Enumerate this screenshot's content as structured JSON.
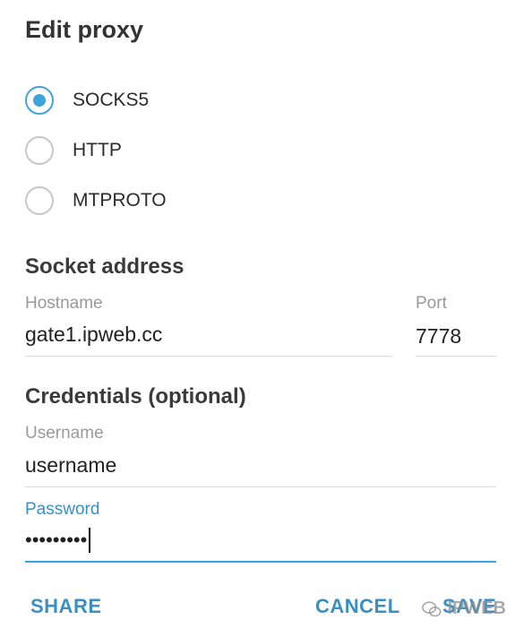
{
  "dialog": {
    "title": "Edit proxy"
  },
  "proxy_type": {
    "options": [
      {
        "label": "SOCKS5",
        "checked": true
      },
      {
        "label": "HTTP",
        "checked": false
      },
      {
        "label": "MTPROTO",
        "checked": false
      }
    ]
  },
  "socket_address": {
    "section_title": "Socket address",
    "hostname": {
      "label": "Hostname",
      "value": "gate1.ipweb.cc"
    },
    "port": {
      "label": "Port",
      "value": "7778"
    }
  },
  "credentials": {
    "section_title": "Credentials (optional)",
    "username": {
      "label": "Username",
      "value": "username"
    },
    "password": {
      "label": "Password",
      "value": "•••••••••"
    }
  },
  "actions": {
    "share_label": "SHARE",
    "cancel_label": "CANCEL",
    "save_label": "SAVE"
  },
  "watermark": {
    "text": "IPWEB"
  },
  "colors": {
    "accent": "#3fa3dc",
    "accent_text": "#3a8fc4",
    "muted_label": "#9a9a9a"
  }
}
